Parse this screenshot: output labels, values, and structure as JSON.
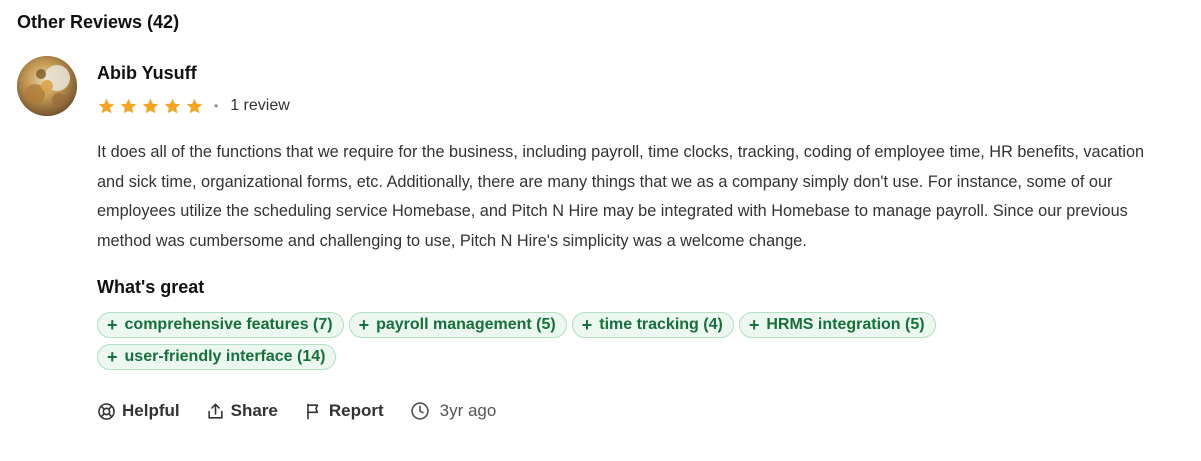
{
  "section": {
    "title": "Other Reviews (42)"
  },
  "review": {
    "reviewer_name": "Abib Yusuff",
    "rating": 5,
    "rating_max": 5,
    "review_count_label": "1 review",
    "text": "It does all of the functions that we require for the business, including payroll, time clocks, tracking, coding of employee time, HR benefits, vacation and sick time, organizational forms, etc. Additionally, there are many things that we as a company simply don't use. For instance, some of our employees utilize the scheduling service Homebase, and Pitch N Hire may be integrated with Homebase to manage payroll. Since our previous method was cumbersome and challenging to use, Pitch N Hire's simplicity was a welcome change.",
    "whats_great_label": "What's great",
    "tags": [
      {
        "plus": "+",
        "label": "comprehensive features (7)"
      },
      {
        "plus": "+",
        "label": "payroll management (5)"
      },
      {
        "plus": "+",
        "label": "time tracking (4)"
      },
      {
        "plus": "+",
        "label": "HRMS integration (5)"
      },
      {
        "plus": "+",
        "label": "user-friendly interface (14)"
      }
    ],
    "actions": {
      "helpful": "Helpful",
      "share": "Share",
      "report": "Report",
      "time_ago": "3yr ago"
    }
  },
  "colors": {
    "star": "#f5a524",
    "tag_bg": "#ebf7ef",
    "tag_border": "#b3dfc2",
    "tag_text": "#15703a"
  },
  "icons": {
    "helpful": "lifebuoy-icon",
    "share": "share-icon",
    "report": "flag-icon",
    "time": "clock-icon",
    "star": "star-icon"
  }
}
